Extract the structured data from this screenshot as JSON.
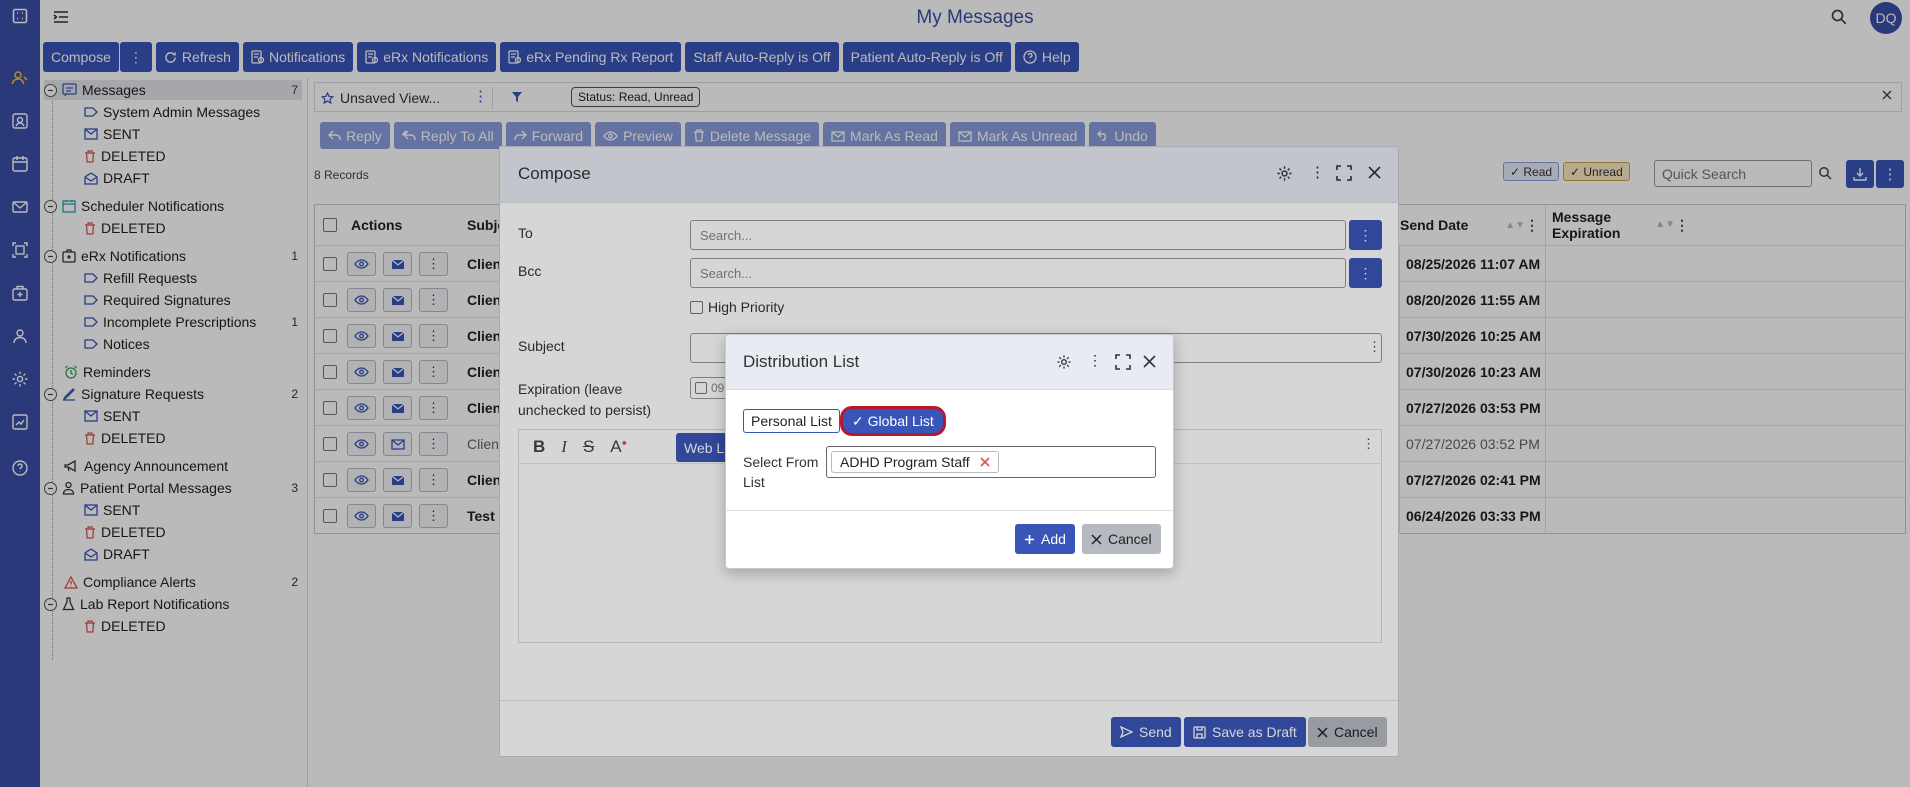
{
  "header": {
    "title": "My Messages",
    "avatar_initials": "DQ"
  },
  "toolbar": {
    "compose": "Compose",
    "refresh": "Refresh",
    "notifications": "Notifications",
    "erx_notifications": "eRx Notifications",
    "erx_pending": "eRx Pending Rx Report",
    "staff_auto_reply": "Staff Auto-Reply is Off",
    "patient_auto_reply": "Patient Auto-Reply is Off",
    "help": "Help"
  },
  "sidebar": {
    "messages": "Messages",
    "messages_count": "7",
    "system_admin": "System Admin Messages",
    "sent": "SENT",
    "deleted": "DELETED",
    "draft": "DRAFT",
    "scheduler": "Scheduler Notifications",
    "erx": "eRx Notifications",
    "erx_count": "1",
    "refill": "Refill Requests",
    "required_sig": "Required Signatures",
    "incomplete_rx": "Incomplete Prescriptions",
    "incomplete_count": "1",
    "notices": "Notices",
    "reminders": "Reminders",
    "signature_requests": "Signature Requests",
    "signature_count": "2",
    "agency": "Agency Announcement",
    "patient_portal": "Patient Portal Messages",
    "patient_portal_count": "3",
    "compliance": "Compliance Alerts",
    "compliance_count": "2",
    "lab_report": "Lab Report Notifications"
  },
  "filter": {
    "view": "Unsaved View...",
    "status_chip": "Status: Read, Unread"
  },
  "actions": {
    "reply": "Reply",
    "reply_all": "Reply To All",
    "forward": "Forward",
    "preview": "Preview",
    "delete": "Delete Message",
    "mark_read": "Mark As Read",
    "mark_unread": "Mark As Unread",
    "undo": "Undo"
  },
  "records": "8 Records",
  "legend": {
    "read": "✓ Read",
    "unread": "✓ Unread"
  },
  "quick_search": {
    "placeholder": "Quick Search"
  },
  "table": {
    "col_actions": "Actions",
    "col_subject": "Subje",
    "col_send_date": "Send Date",
    "col_expiration": "Message Expiration",
    "rows": [
      {
        "subject": "Client",
        "date": "08/25/2026 11:07 AM",
        "bold": true
      },
      {
        "subject": "Client",
        "date": "08/20/2026 11:55 AM",
        "bold": true
      },
      {
        "subject": "Client",
        "date": "07/30/2026 10:25 AM",
        "bold": true
      },
      {
        "subject": "Client",
        "date": "07/30/2026 10:23 AM",
        "bold": true
      },
      {
        "subject": "Client",
        "date": "07/27/2026 03:53 PM",
        "bold": true
      },
      {
        "subject": "Client",
        "date": "07/27/2026 03:52 PM",
        "bold": false
      },
      {
        "subject": "Client",
        "date": "07/27/2026 02:41 PM",
        "bold": true
      },
      {
        "subject": "Test F",
        "date": "06/24/2026 03:33 PM",
        "bold": true
      }
    ]
  },
  "compose": {
    "title": "Compose",
    "to_label": "To",
    "to_placeholder": "Search...",
    "bcc_label": "Bcc",
    "bcc_placeholder": "Search...",
    "high_priority": "High Priority",
    "subject_label": "Subject",
    "expiration_label": "Expiration (leave unchecked to persist)",
    "expiration_partial": "09",
    "web_link": "Web Link",
    "send": "Send",
    "save_draft": "Save as Draft",
    "cancel": "Cancel"
  },
  "distribution": {
    "title": "Distribution List",
    "personal": "Personal List",
    "global": "✓ Global List",
    "select_label": "Select From List",
    "selected": "ADHD Program Staff",
    "add": "Add",
    "cancel": "Cancel"
  },
  "colors": {
    "primary": "#3a55b8",
    "rail": "#3a4fa8",
    "highlight_ring": "#b5192e"
  }
}
